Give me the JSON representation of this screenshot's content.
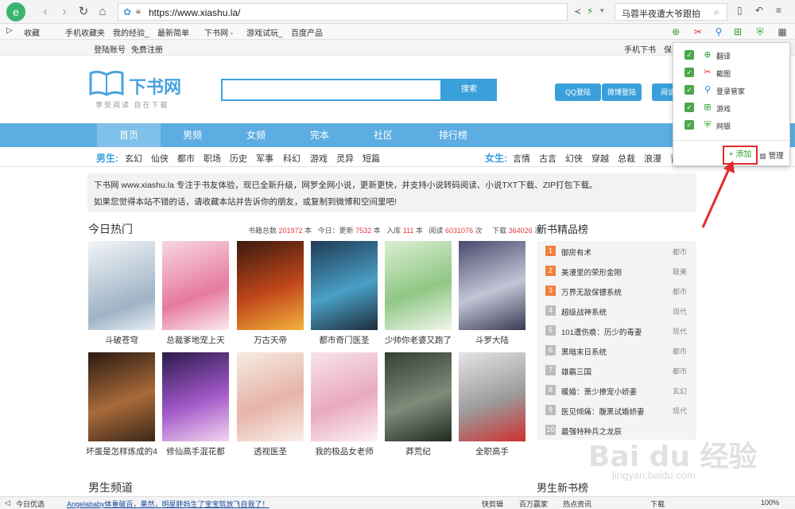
{
  "browser": {
    "url": "https://www.xiashu.la/",
    "search_text": "马蓉半夜遭大爷跟拍",
    "favorites": [
      "收藏",
      "手机收藏夹",
      "我的经验_",
      "最新简单",
      "下书网 -",
      "游戏试玩_",
      "百度产品"
    ]
  },
  "site": {
    "top_links": [
      "登陆账号",
      "免费注册",
      "手机下书",
      "保"
    ],
    "logo_name": "下书网",
    "logo_slogan": "享受阅读  自在下载",
    "search_button": "搜索",
    "login_buttons": [
      "QQ登陆",
      "微博登陆",
      "阅读"
    ],
    "nav": [
      "首页",
      "男频",
      "女频",
      "完本",
      "社区",
      "排行榜"
    ],
    "male_label": "男生:",
    "male_cats": [
      "玄幻",
      "仙侠",
      "都市",
      "职场",
      "历史",
      "军事",
      "科幻",
      "游戏",
      "灵异",
      "短篇"
    ],
    "female_label": "女生:",
    "female_cats": [
      "言情",
      "古言",
      "幻侠",
      "穿越",
      "总裁",
      "浪漫",
      "青"
    ],
    "notice_line1": "下书网 www.xiashu.la 专注于书友体验，现已全新升级，网罗全网小说，更新更快，并支持小说转码阅读、小说TXT下载、ZIP打包下载。",
    "notice_line2": "如果您觉得本站不错的话，请收藏本站并告诉你的朋友，或复制到微博和空间里吧!",
    "hot_title": "今日热门",
    "stats": {
      "total_label": "书籍总数",
      "total": "201972",
      "unit": "本",
      "today_label": "今日：更新",
      "today": "7532",
      "stock_label": "入库",
      "stock": "111",
      "read_label": "阅读",
      "read": "6031076",
      "times": "次",
      "dl_label": "下载",
      "dl": "364026"
    },
    "books_row1": [
      "斗破苍穹",
      "总裁爹地宠上天",
      "万古天帝",
      "都市奇门医圣",
      "少帅你老婆又跑了",
      "斗罗大陆"
    ],
    "books_row2": [
      "坏蛋是怎样炼成的4",
      "修仙高手混花都",
      "透视医圣",
      "我的极品女老师",
      "莽荒纪",
      "全职高手"
    ],
    "rank_title": "新书精品榜",
    "rank": [
      {
        "n": "1",
        "name": "御房有术",
        "cat": "都市"
      },
      {
        "n": "2",
        "name": "美漫里的荣形金刚",
        "cat": "联美"
      },
      {
        "n": "3",
        "name": "万界无敌保镖系统",
        "cat": "都市"
      },
      {
        "n": "4",
        "name": "超级战神系统",
        "cat": "现代"
      },
      {
        "n": "5",
        "name": "101遭伤痕：历少的毒妻",
        "cat": "现代"
      },
      {
        "n": "6",
        "name": "黑暗末日系统",
        "cat": "都市"
      },
      {
        "n": "7",
        "name": "雄霸三国",
        "cat": "都市"
      },
      {
        "n": "8",
        "name": "暖婚：萧少撩宠小娇妻",
        "cat": "玄幻"
      },
      {
        "n": "9",
        "name": "医见倾痛：腹黑试婚娇妻",
        "cat": "现代"
      },
      {
        "n": "10",
        "name": "最强特种兵之龙辰",
        "cat": ""
      }
    ],
    "male_channel": "男生频道",
    "male_new": "男生新书榜"
  },
  "popup": {
    "items": [
      "翻译",
      "截图",
      "登录管家",
      "游戏",
      "网银"
    ],
    "add": "添加",
    "manage": "管理"
  },
  "statusbar": {
    "left": "今日优选",
    "news": "Angelababy体重破百，果然，明星胖妈生了宝宝就放飞自我了！",
    "items": [
      "快剪辑",
      "百万赢家",
      "热点资讯",
      "",
      "下载",
      "",
      "",
      "100%"
    ]
  },
  "watermark": "Bai du 经验",
  "watermark_url": "jingyan.baidu.com",
  "colors": {
    "accent": "#3aa0dc",
    "nav": "#5dade2",
    "rank_top": "#f07f3c",
    "stats_red": "#e4393c",
    "highlight": "#e42a2a"
  }
}
